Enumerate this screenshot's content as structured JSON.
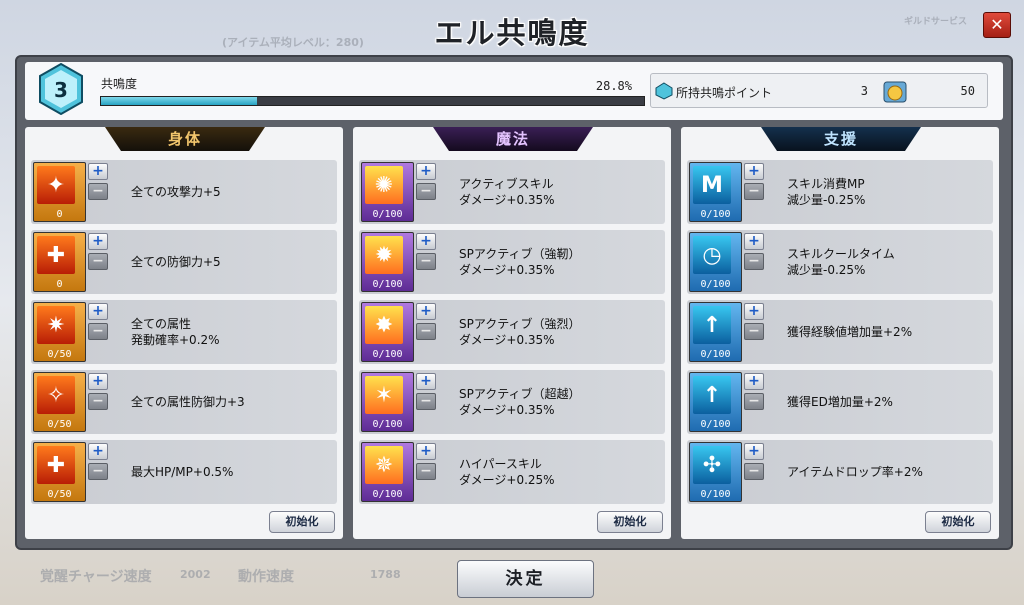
{
  "window": {
    "title": "エル共鳴度",
    "close_label": "✕"
  },
  "background": {
    "texts": [
      "(アイテム平均レベル：280)",
      "ギルドサービス",
      "覚醒チャージ速度",
      "2002",
      "動作速度",
      "1788"
    ]
  },
  "resonance": {
    "level": "3",
    "label": "共鳴度",
    "percent_text": "28.8%",
    "progress": 0.288
  },
  "points": {
    "label": "所持共鳴ポイント",
    "value": "3",
    "secondary_value": "50"
  },
  "columns": [
    {
      "name": "身体",
      "theme": "body",
      "reset_label": "初始化",
      "items": [
        {
          "count": "0",
          "desc": "全ての攻撃力+5",
          "icon": "attack-icon"
        },
        {
          "count": "0",
          "desc": "全ての防御力+5",
          "icon": "defense-icon"
        },
        {
          "count": "0/50",
          "desc": "全ての属性\n発動確率+0.2%",
          "icon": "element-activate-icon"
        },
        {
          "count": "0/50",
          "desc": "全ての属性防御力+3",
          "icon": "element-defense-icon"
        },
        {
          "count": "0/50",
          "desc": "最大HP/MP+0.5%",
          "icon": "hp-mp-icon"
        }
      ]
    },
    {
      "name": "魔法",
      "theme": "magic",
      "reset_label": "初始化",
      "items": [
        {
          "count": "0/100",
          "desc": "アクティブスキル\nダメージ+0.35%",
          "icon": "active-skill-icon"
        },
        {
          "count": "0/100",
          "desc": "SPアクティブ（強靭）\nダメージ+0.35%",
          "icon": "sp-tough-icon"
        },
        {
          "count": "0/100",
          "desc": "SPアクティブ（強烈）\nダメージ+0.35%",
          "icon": "sp-intense-icon"
        },
        {
          "count": "0/100",
          "desc": "SPアクティブ（超越）\nダメージ+0.35%",
          "icon": "sp-transcend-icon"
        },
        {
          "count": "0/100",
          "desc": "ハイパースキル\nダメージ+0.25%",
          "icon": "hyper-skill-icon"
        }
      ]
    },
    {
      "name": "支援",
      "theme": "support",
      "reset_label": "初始化",
      "items": [
        {
          "count": "0/100",
          "desc": "スキル消費MP\n減少量-0.25%",
          "icon": "mp-cost-icon"
        },
        {
          "count": "0/100",
          "desc": "スキルクールタイム\n減少量-0.25%",
          "icon": "cooldown-icon"
        },
        {
          "count": "0/100",
          "desc": "獲得経験値増加量+2%",
          "icon": "exp-icon"
        },
        {
          "count": "0/100",
          "desc": "獲得ED増加量+2%",
          "icon": "ed-icon"
        },
        {
          "count": "0/100",
          "desc": "アイテムドロップ率+2%",
          "icon": "drop-rate-icon"
        }
      ]
    }
  ],
  "footer": {
    "confirm_label": "決定"
  },
  "colors": {
    "body": "#c98a1f",
    "magic": "#7a3fb5",
    "support": "#2a83c9",
    "progress": "#27a3c3"
  }
}
